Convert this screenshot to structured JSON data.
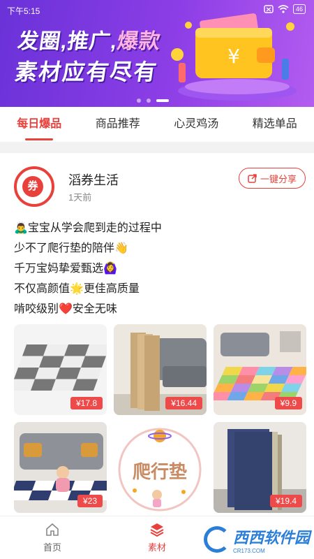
{
  "status_bar": {
    "time": "下午5:15",
    "battery": "46"
  },
  "banner": {
    "line1_part1": "发圈,推广,",
    "line1_part2": "爆款",
    "line2": "素材应有尽有",
    "art_symbol": "¥"
  },
  "tabs": [
    {
      "label": "每日爆品",
      "active": true
    },
    {
      "label": "商品推荐",
      "active": false
    },
    {
      "label": "心灵鸡汤",
      "active": false
    },
    {
      "label": "精选单品",
      "active": false
    }
  ],
  "post": {
    "avatar_char": "券",
    "author": "滔券生活",
    "time": "1天前",
    "share_label": "一键分享",
    "lines": [
      "🙇‍♂️宝宝从学会爬到走的过程中",
      "少不了爬行垫的陪伴👋",
      "千万宝妈挚爱甄选🙆‍♀️",
      "不仅高颜值🌟更佳高质量",
      "啃咬级别❤️安全无味"
    ],
    "images": [
      {
        "price": "¥17.8",
        "icon": "gray-white-puzzle-mat"
      },
      {
        "price": "¥16.44",
        "icon": "wood-grain-mat-stack"
      },
      {
        "price": "¥9.9",
        "icon": "colorful-mat-living-room"
      },
      {
        "price": "¥23",
        "icon": "child-on-mat"
      },
      {
        "price": "",
        "text": "爬行垫",
        "icon": "crawling-mat-logo"
      },
      {
        "price": "¥19.4",
        "icon": "navy-mat-stack"
      }
    ]
  },
  "bottom_nav": [
    {
      "label": "首页",
      "icon": "home-icon",
      "active": false
    },
    {
      "label": "素材",
      "icon": "layers-icon",
      "active": true
    }
  ],
  "watermark": {
    "text": "西西软件园",
    "sub": "CR173.COM"
  },
  "colors": {
    "accent": "#e8413c",
    "banner": "#7a36e0",
    "price_tag": "#ee4a4a"
  }
}
